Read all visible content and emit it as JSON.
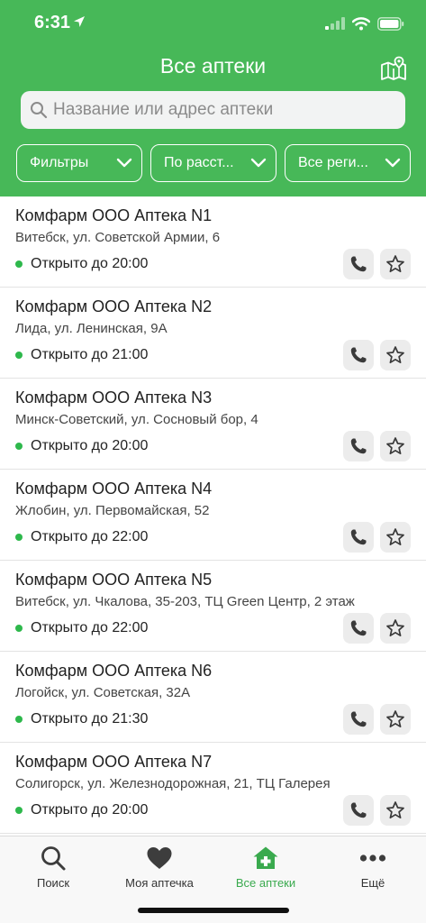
{
  "status_bar": {
    "time": "6:31"
  },
  "header": {
    "title": "Все аптеки",
    "search_placeholder": "Название или адрес аптеки"
  },
  "filters": [
    {
      "label": "Фильтры"
    },
    {
      "label": "По расст..."
    },
    {
      "label": "Все реги..."
    }
  ],
  "pharmacies": [
    {
      "name": "Комфарм ООО Аптека N1",
      "address": "Витебск, ул. Советской Армии, 6",
      "status": "Открыто до 20:00"
    },
    {
      "name": "Комфарм ООО Аптека N2",
      "address": "Лида, ул. Ленинская, 9А",
      "status": "Открыто до 21:00"
    },
    {
      "name": "Комфарм ООО Аптека N3",
      "address": "Минск-Советский, ул. Сосновый бор, 4",
      "status": "Открыто до 20:00"
    },
    {
      "name": "Комфарм ООО Аптека N4",
      "address": "Жлобин, ул. Первомайская, 52",
      "status": "Открыто до 22:00"
    },
    {
      "name": "Комфарм ООО Аптека N5",
      "address": "Витебск, ул. Чкалова, 35-203, ТЦ Green Центр, 2 этаж",
      "status": "Открыто до 22:00"
    },
    {
      "name": "Комфарм ООО Аптека N6",
      "address": "Логойск, ул. Советская, 32А",
      "status": "Открыто до 21:30"
    },
    {
      "name": "Комфарм ООО Аптека N7",
      "address": "Солигорск, ул. Железнодорожная, 21, ТЦ Галерея",
      "status": "Открыто до 20:00"
    }
  ],
  "tabs": [
    {
      "label": "Поиск",
      "icon": "search-icon"
    },
    {
      "label": "Моя аптечка",
      "icon": "heart-icon"
    },
    {
      "label": "Все аптеки",
      "icon": "pharmacy-home-icon",
      "active": true
    },
    {
      "label": "Ещё",
      "icon": "more-icon"
    }
  ],
  "colors": {
    "header_bg": "#47b858",
    "status_open": "#2eb84c",
    "tab_active": "#3aaa4e"
  }
}
